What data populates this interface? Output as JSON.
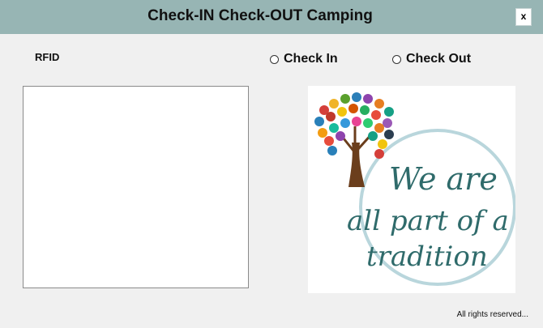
{
  "window": {
    "title": "Check-IN Check-OUT Camping",
    "close_label": "x"
  },
  "form": {
    "rfid_label": "RFID",
    "rfid_value": "",
    "check_in_label": "Check In",
    "check_out_label": "Check Out",
    "check_in_selected": false,
    "check_out_selected": false
  },
  "logo": {
    "line1": "We are",
    "line2": "all part of a",
    "line3": "tradition",
    "text_color": "#2f6b6b",
    "ring_color": "#b9d6dc"
  },
  "footer": {
    "text": "All rights reserved..."
  }
}
